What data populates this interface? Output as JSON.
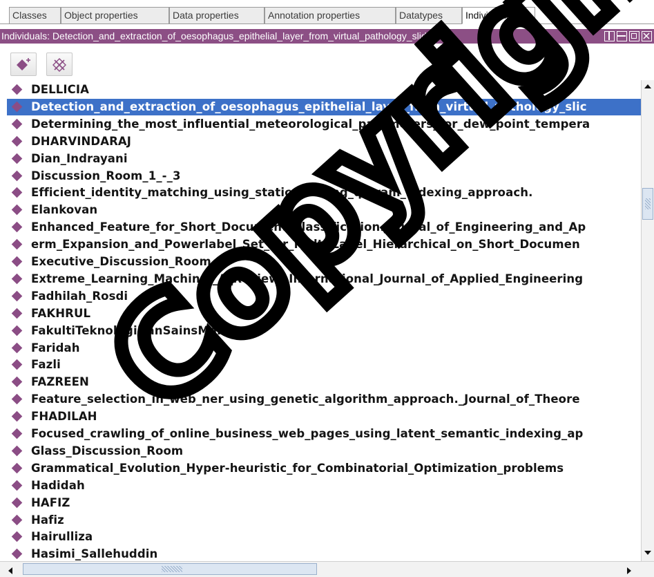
{
  "tabs": [
    {
      "label": "Classes"
    },
    {
      "label": "Object properties"
    },
    {
      "label": "Data properties"
    },
    {
      "label": "Annotation properties"
    },
    {
      "label": "Datatypes"
    },
    {
      "label": "Individuals"
    }
  ],
  "active_tab": "Individuals",
  "panel": {
    "title": "Individuals: Detection_and_extraction_of_oesophagus_epithelial_layer_from_virtual_pathology_slides",
    "window_buttons": [
      "restore-icon",
      "minimize-icon",
      "maximize-icon",
      "close-icon"
    ]
  },
  "toolbar": {
    "buttons": [
      {
        "icon": "add-individual-icon"
      },
      {
        "icon": "delete-individual-icon"
      }
    ]
  },
  "individuals": [
    "DELLICIA",
    "Detection_and_extraction_of_oesophagus_epithelial_layer_from_virtual_pathology_slic",
    "Determining_the_most_influential_meteorological_parameters_for_dew_point_tempera",
    "DHARVINDARAJ",
    "Dian_Indrayani",
    "Discussion_Room_1_-_3",
    "Efficient_identity_matching_using_static_pruning_q-gram_indexing_approach.",
    "Elankovan",
    "Enhanced_Feature_for_Short_Document_Classification.Journal_of_Engineering_and_Ap",
    "erm_Expansion_and_Powerlabel_Set_for_Multi-Label_Hierarchical_on_Short_Documen",
    "Executive_Discussion_Room",
    "Extreme_Learning_Machine:_A_Review._International_Journal_of_Applied_Engineering",
    "Fadhilah_Rosdi",
    "FAKHRUL",
    "FakultiTeknologiDanSainsMaklumat",
    "Faridah",
    "Fazli",
    "FAZREEN",
    "Feature_selection_in_web_ner_using_genetic_algorithm_approach._Journal_of_Theore",
    "FHADILAH",
    "Focused_crawling_of_online_business_web_pages_using_latent_semantic_indexing_ap",
    "Glass_Discussion_Room",
    "Grammatical_Evolution_Hyper-heuristic_for_Combinatorial_Optimization_problems",
    "Hadidah",
    "HAFIZ",
    "Hafiz",
    "Hairulliza",
    "Hasimi_Sallehuddin"
  ],
  "selected_index": 1,
  "colors": {
    "title_bar": "#8c4f85",
    "selection": "#3d71c8",
    "individual_icon": "#8b4d85"
  },
  "watermark": "Copyright"
}
